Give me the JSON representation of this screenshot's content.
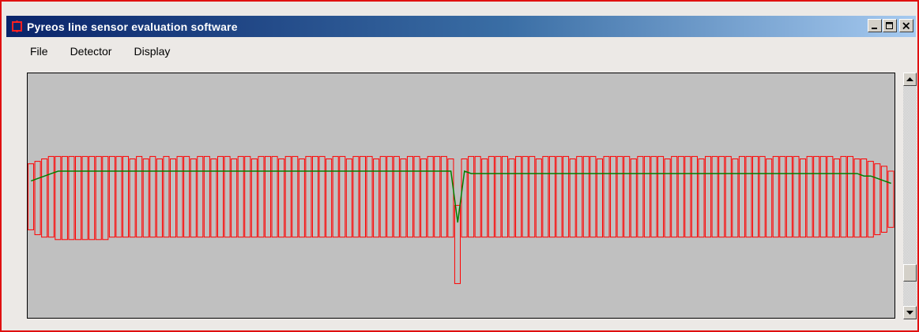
{
  "window": {
    "title": "Pyreos line sensor evaluation software",
    "controls": [
      "minimize",
      "maximize",
      "close"
    ]
  },
  "menu": {
    "items": [
      "File",
      "Detector",
      "Display"
    ]
  },
  "icons": {
    "app": "app-icon",
    "minimize": "minimize-icon",
    "maximize": "maximize-icon",
    "close": "close-icon",
    "scroll_up": "arrow-up-icon",
    "scroll_down": "arrow-down-icon"
  },
  "colors": {
    "titlebar_start": "#0a246a",
    "titlebar_end": "#a6caf0",
    "plot_background": "#c0c0c0",
    "bar_stroke": "#ff0000",
    "line_stroke": "#008000"
  },
  "scrollbar": {
    "position": 0.88
  },
  "chart_data": {
    "type": "bar",
    "pixel_count": 128,
    "ylim": [
      0,
      1
    ],
    "grid": false,
    "series": [
      {
        "values_low": [
          0.36,
          0.34,
          0.33,
          0.33,
          0.32,
          0.32,
          0.32,
          0.32,
          0.32,
          0.32,
          0.32,
          0.32,
          0.33,
          0.33,
          0.33,
          0.33,
          0.33,
          0.33,
          0.33,
          0.33,
          0.33,
          0.33,
          0.33,
          0.33,
          0.33,
          0.33,
          0.33,
          0.33,
          0.33,
          0.33,
          0.33,
          0.33,
          0.33,
          0.33,
          0.33,
          0.33,
          0.33,
          0.33,
          0.33,
          0.33,
          0.33,
          0.33,
          0.33,
          0.33,
          0.33,
          0.33,
          0.33,
          0.33,
          0.33,
          0.33,
          0.33,
          0.33,
          0.33,
          0.33,
          0.33,
          0.33,
          0.33,
          0.33,
          0.33,
          0.33,
          0.33,
          0.33,
          0.33,
          0.14,
          0.33,
          0.33,
          0.33,
          0.33,
          0.33,
          0.33,
          0.33,
          0.33,
          0.33,
          0.33,
          0.33,
          0.33,
          0.33,
          0.33,
          0.33,
          0.33,
          0.33,
          0.33,
          0.33,
          0.33,
          0.33,
          0.33,
          0.33,
          0.33,
          0.33,
          0.33,
          0.33,
          0.33,
          0.33,
          0.33,
          0.33,
          0.33,
          0.33,
          0.33,
          0.33,
          0.33,
          0.33,
          0.33,
          0.33,
          0.33,
          0.33,
          0.33,
          0.33,
          0.33,
          0.33,
          0.33,
          0.33,
          0.33,
          0.33,
          0.33,
          0.33,
          0.33,
          0.33,
          0.33,
          0.33,
          0.33,
          0.33,
          0.33,
          0.33,
          0.33,
          0.33,
          0.34,
          0.35,
          0.37
        ],
        "values_high": [
          0.63,
          0.64,
          0.65,
          0.66,
          0.66,
          0.66,
          0.66,
          0.66,
          0.66,
          0.66,
          0.66,
          0.66,
          0.66,
          0.66,
          0.66,
          0.65,
          0.66,
          0.65,
          0.66,
          0.65,
          0.66,
          0.65,
          0.66,
          0.66,
          0.65,
          0.66,
          0.66,
          0.65,
          0.66,
          0.66,
          0.65,
          0.66,
          0.66,
          0.65,
          0.66,
          0.66,
          0.66,
          0.65,
          0.66,
          0.66,
          0.65,
          0.66,
          0.66,
          0.66,
          0.65,
          0.66,
          0.66,
          0.65,
          0.66,
          0.66,
          0.66,
          0.65,
          0.66,
          0.66,
          0.66,
          0.65,
          0.66,
          0.66,
          0.65,
          0.66,
          0.66,
          0.66,
          0.65,
          0.46,
          0.65,
          0.66,
          0.66,
          0.65,
          0.66,
          0.66,
          0.66,
          0.65,
          0.66,
          0.66,
          0.66,
          0.65,
          0.66,
          0.66,
          0.66,
          0.66,
          0.65,
          0.66,
          0.66,
          0.66,
          0.65,
          0.66,
          0.66,
          0.66,
          0.66,
          0.65,
          0.66,
          0.66,
          0.66,
          0.66,
          0.65,
          0.66,
          0.66,
          0.66,
          0.66,
          0.65,
          0.66,
          0.66,
          0.66,
          0.66,
          0.65,
          0.66,
          0.66,
          0.66,
          0.66,
          0.65,
          0.66,
          0.66,
          0.66,
          0.66,
          0.65,
          0.66,
          0.66,
          0.66,
          0.66,
          0.65,
          0.66,
          0.66,
          0.65,
          0.65,
          0.64,
          0.63,
          0.62,
          0.6
        ],
        "values_mean": [
          0.56,
          0.57,
          0.58,
          0.59,
          0.6,
          0.6,
          0.6,
          0.6,
          0.6,
          0.6,
          0.6,
          0.6,
          0.6,
          0.6,
          0.6,
          0.6,
          0.6,
          0.6,
          0.6,
          0.6,
          0.6,
          0.6,
          0.6,
          0.6,
          0.6,
          0.6,
          0.6,
          0.6,
          0.6,
          0.6,
          0.6,
          0.6,
          0.6,
          0.6,
          0.6,
          0.6,
          0.6,
          0.6,
          0.6,
          0.6,
          0.6,
          0.6,
          0.6,
          0.6,
          0.6,
          0.6,
          0.6,
          0.6,
          0.6,
          0.6,
          0.6,
          0.6,
          0.6,
          0.6,
          0.6,
          0.6,
          0.6,
          0.6,
          0.6,
          0.6,
          0.6,
          0.6,
          0.6,
          0.39,
          0.6,
          0.59,
          0.59,
          0.59,
          0.59,
          0.59,
          0.59,
          0.59,
          0.59,
          0.59,
          0.59,
          0.59,
          0.59,
          0.59,
          0.59,
          0.59,
          0.59,
          0.59,
          0.59,
          0.59,
          0.59,
          0.59,
          0.59,
          0.59,
          0.59,
          0.59,
          0.59,
          0.59,
          0.59,
          0.59,
          0.59,
          0.59,
          0.59,
          0.59,
          0.59,
          0.59,
          0.59,
          0.59,
          0.59,
          0.59,
          0.59,
          0.59,
          0.59,
          0.59,
          0.59,
          0.59,
          0.59,
          0.59,
          0.59,
          0.59,
          0.59,
          0.59,
          0.59,
          0.59,
          0.59,
          0.59,
          0.59,
          0.59,
          0.59,
          0.58,
          0.58,
          0.57,
          0.56,
          0.55
        ]
      }
    ]
  }
}
